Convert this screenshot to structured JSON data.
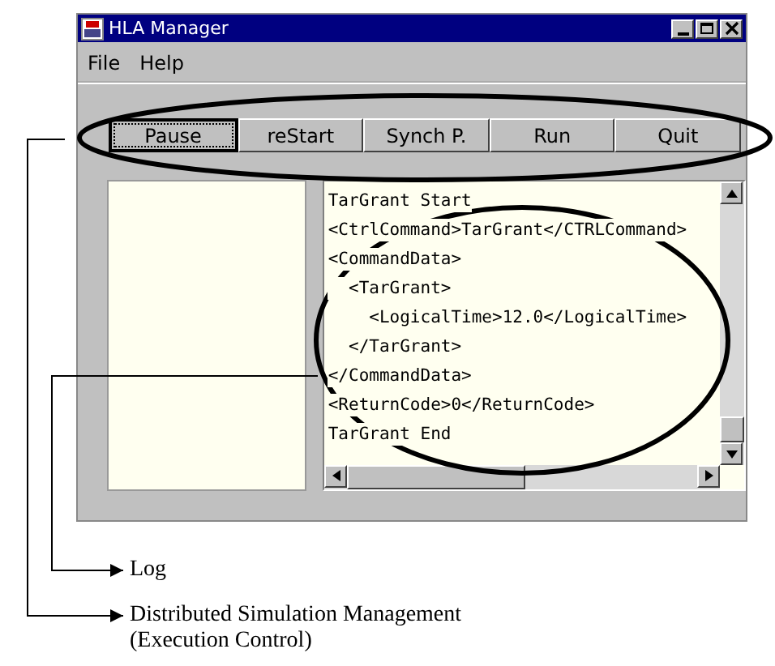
{
  "window": {
    "title": "HLA Manager"
  },
  "menu": [
    "File",
    "Help"
  ],
  "buttons": [
    {
      "label": "Pause",
      "focused": true
    },
    {
      "label": "reStart",
      "focused": false
    },
    {
      "label": "Synch P.",
      "focused": false
    },
    {
      "label": "Run",
      "focused": false
    },
    {
      "label": "Quit",
      "focused": false
    }
  ],
  "log_lines": [
    "TarGrant Start",
    "<CtrlCommand>TarGrant</CTRLCommand>",
    "<CommandData>",
    "  <TarGrant>",
    "    <LogicalTime>12.0</LogicalTime>",
    "  </TarGrant>",
    "</CommandData>",
    "<ReturnCode>0</ReturnCode>",
    "TarGrant End"
  ],
  "annotations": [
    {
      "label": "Log"
    },
    {
      "label": "Distributed Simulation Management",
      "sublabel": "(Execution Control)"
    }
  ]
}
